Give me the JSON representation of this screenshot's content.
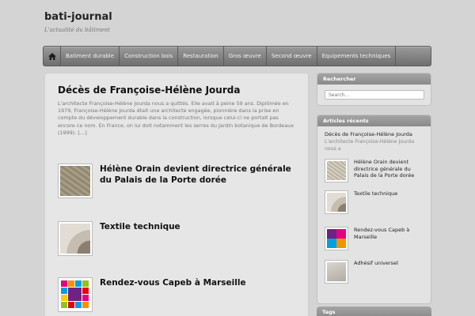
{
  "site": {
    "title": "bati-journal",
    "tagline": "L'actualité du bâtiment"
  },
  "nav": {
    "home_icon": "home-icon",
    "items": [
      "Batiment durable",
      "Construction bois",
      "Restauration",
      "Gros œuvre",
      "Second œuvre",
      "Equipements techniques"
    ]
  },
  "featured": {
    "title": "Décès de Françoise-Hélène Jourda",
    "excerpt": "L'architecte Françoise-Hélène Jourda nous a quittés. Elle avait à peine 59 ans. Diplômée en 1979, Françoise-Hélène Jourda était une architecte engagée, pionnière dans la prise en compte du développement durable dans la construction, lorsque celui-ci ne portait pas encore ce nom. En France, on lui doit notamment les serres du Jardin botanique de Bordeaux (1999). […]"
  },
  "posts": [
    {
      "title": "Hélène Orain devient directrice générale du Palais de la Porte dorée"
    },
    {
      "title": "Textile technique"
    },
    {
      "title": "Rendez-vous Capeb à Marseille"
    }
  ],
  "sidebar": {
    "search": {
      "heading": "Rechercher",
      "placeholder": "Search..."
    },
    "recent": {
      "heading": "Articles récents",
      "first_title": "Décès de Françoise-Hélène Jourda",
      "first_excerpt": "L'architecte Françoise-Hélène Jourda nous a",
      "items": [
        {
          "title": "Hélène Orain devient directrice générale du Palais de la Porte dorée"
        },
        {
          "title": "Textile technique"
        },
        {
          "title": "Rendez-vous Capeb à Marseille"
        },
        {
          "title": "Adhésif universel"
        }
      ]
    },
    "tags": {
      "heading": "Tags"
    }
  }
}
